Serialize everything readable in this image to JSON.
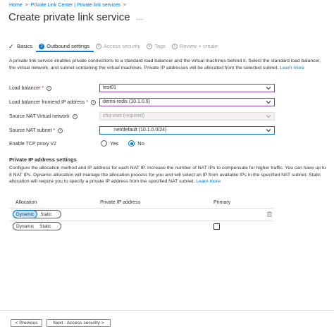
{
  "breadcrumb": {
    "items": [
      "Home",
      "Private Link Center | Private link services"
    ],
    "separator": ">"
  },
  "page": {
    "title": "Create private link service",
    "more": "..."
  },
  "steps": [
    {
      "label": "Basics",
      "state": "complete",
      "marker": "✓"
    },
    {
      "label": "Outbound settings",
      "state": "active",
      "marker": "2"
    },
    {
      "label": "Access security",
      "state": "disabled",
      "marker": "3"
    },
    {
      "label": "Tags",
      "state": "disabled",
      "marker": "4"
    },
    {
      "label": "Review + create",
      "state": "disabled",
      "marker": "5"
    }
  ],
  "description": {
    "text": "A private link service enables private connections to a standard load balancer and the virtual machines behind it. Select the standard load balancer, the virtual network, and subnet containing the virtual machines. Private IP addresses will be allocated from the selected subnet.",
    "learn_more": "Learn more"
  },
  "form": {
    "load_balancer": {
      "label": "Load balancer",
      "required": "*",
      "value": "test01"
    },
    "frontend_ip": {
      "label": "Load balancer frontend IP address",
      "required": "*",
      "value": "demo-redis (10.1.0.9)"
    },
    "source_vnet": {
      "label": "Source NAT Virtual network",
      "value": "chq-vnet (required)"
    },
    "source_subnet": {
      "label": "Source NAT subnet",
      "required": "*",
      "value": "net/default (10.1.0.0/24)"
    },
    "tcp_proxy": {
      "label": "Enable TCP proxy V2",
      "options": [
        "Yes",
        "No"
      ],
      "selected": "No"
    }
  },
  "ip_settings": {
    "title": "Private IP address settings",
    "text": "Configure the allocation method and IP address for each NAT IP. Increase the number of NAT IPs to compensate for higher traffic. You can have up to 8 NAT IPs. Dynamic allocation will manage the allocation process for you and will select an IP from available IPs in the specified NAT subnet. Static allocation will require you to specify a private IP address from the specified NAT subnet.",
    "learn_more": "Learn more",
    "columns": [
      "Allocation",
      "Private IP address",
      "Primary"
    ],
    "rows": [
      {
        "allocation_options": [
          "Dynamic",
          "Static"
        ],
        "selected": "Dynamic",
        "ip": "",
        "primary": false
      },
      {
        "allocation_options": [
          "Dynamic",
          "Static"
        ],
        "selected": "",
        "ip": "",
        "primary": false
      }
    ]
  },
  "footer": {
    "previous": "< Previous",
    "next": "Next : Access security >"
  },
  "icons": {
    "info": "info-icon",
    "chevron": "chevron-down-icon",
    "trash": "trash-icon",
    "check": "checkmark-icon"
  },
  "colors": {
    "accent": "#0078d4",
    "required": "#a4262c",
    "focus_border": "#8a3f9c"
  }
}
